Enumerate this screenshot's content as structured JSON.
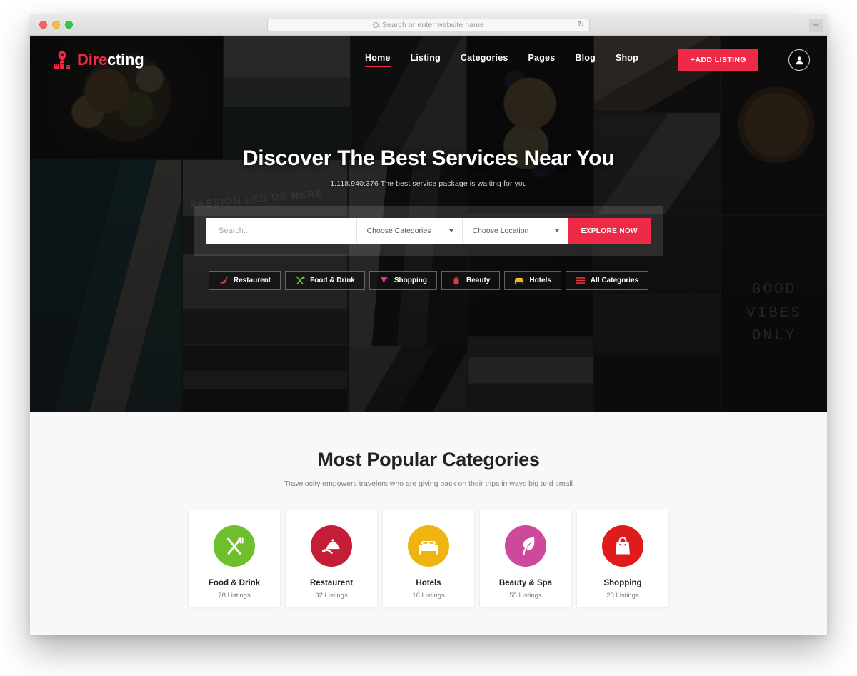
{
  "browser": {
    "url_placeholder": "Search or enter website name",
    "search_icon": "search-icon",
    "reload_icon": "reload-icon",
    "new_tab_label": "+"
  },
  "header": {
    "brand_accent": "Dire",
    "brand_rest": "cting",
    "logo_icon": "map-pin-buildings-icon",
    "nav": [
      {
        "label": "Home",
        "active": true
      },
      {
        "label": "Listing",
        "active": false
      },
      {
        "label": "Categories",
        "active": false
      },
      {
        "label": "Pages",
        "active": false
      },
      {
        "label": "Blog",
        "active": false
      },
      {
        "label": "Shop",
        "active": false
      }
    ],
    "add_listing_label": "+ADD LISTING",
    "avatar_icon": "user-icon",
    "accent_color": "#ef2a47"
  },
  "hero": {
    "title": "Discover The Best Services Near You",
    "subtitle": "1.118.940:376 The best service package is waiting for you",
    "search": {
      "input_placeholder": "Search...",
      "categories_label": "Choose Categories",
      "location_label": "Choose Location",
      "explore_label": "EXPLORE NOW"
    },
    "chips": [
      {
        "label": "Restaurent",
        "icon": "chili-pepper-icon",
        "color": "#e03a3a"
      },
      {
        "label": "Food & Drink",
        "icon": "fork-knife-icon",
        "color": "#7cc043"
      },
      {
        "label": "Shopping",
        "icon": "shopping-tag-icon",
        "color": "#e2369e"
      },
      {
        "label": "Beauty",
        "icon": "beauty-bottle-icon",
        "color": "#e23a3a"
      },
      {
        "label": "Hotels",
        "icon": "bed-icon",
        "color": "#f0b323"
      },
      {
        "label": "All Categories",
        "icon": "menu-lines-icon",
        "color": "#e03a3a"
      }
    ],
    "photo_text": {
      "passion": "PASSION LED US HERE",
      "vibes_line1": "GOOD",
      "vibes_line2": "VIBES",
      "vibes_line3": "ONLY"
    }
  },
  "categories_section": {
    "title": "Most Popular Categories",
    "subtitle": "Travelocity empowers travelers who are giving back on their trips in ways big and small",
    "cards": [
      {
        "name": "Food & Drink",
        "count": "78 Listings",
        "color": "#6fbe2c",
        "icon": "fork-knife-icon"
      },
      {
        "name": "Restaurent",
        "count": "32 Listings",
        "color": "#c51d38",
        "icon": "serving-tray-icon"
      },
      {
        "name": "Hotels",
        "count": "16 Listings",
        "color": "#efb312",
        "icon": "bed-icon"
      },
      {
        "name": "Beauty & Spa",
        "count": "55 Listings",
        "color": "#ce489c",
        "icon": "leaf-icon"
      },
      {
        "name": "Shopping",
        "count": "23 Listings",
        "color": "#e01b1b",
        "icon": "shopping-bag-icon"
      }
    ]
  }
}
